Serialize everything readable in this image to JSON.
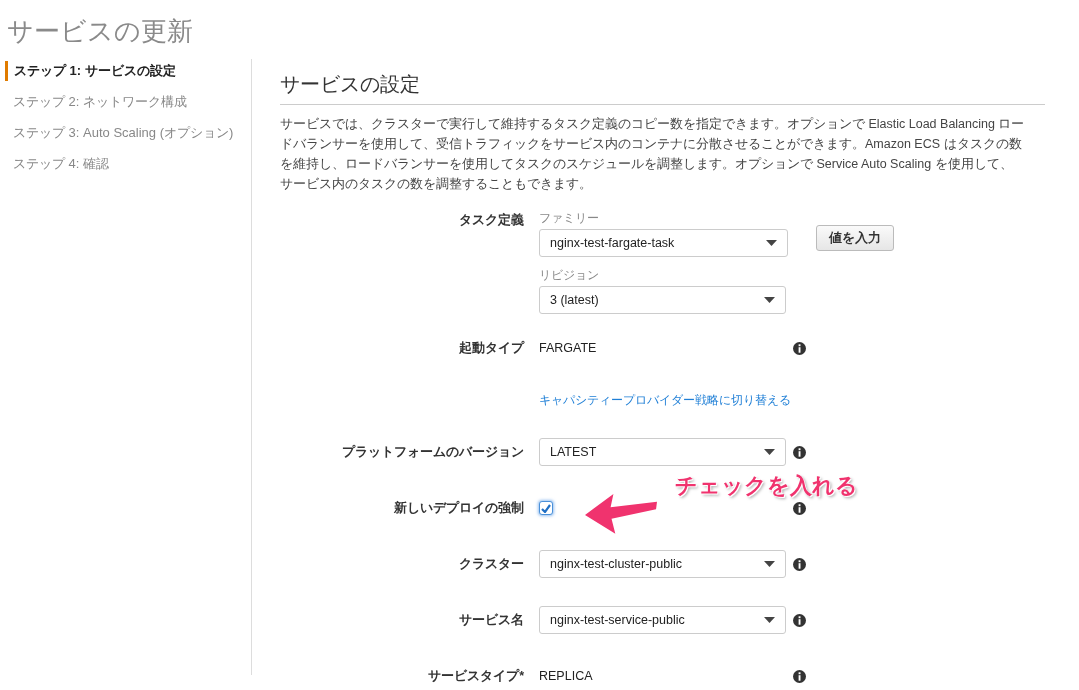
{
  "page_title": "サービスの更新",
  "steps": [
    {
      "label": "ステップ 1: サービスの設定",
      "selected": true
    },
    {
      "label": "ステップ 2: ネットワーク構成",
      "selected": false
    },
    {
      "label": "ステップ 3: Auto Scaling (オプション)",
      "selected": false
    },
    {
      "label": "ステップ 4: 確認",
      "selected": false
    }
  ],
  "section": {
    "title": "サービスの設定",
    "description": "サービスでは、クラスターで実行して維持するタスク定義のコピー数を指定できます。オプションで Elastic Load Balancing ロードバランサーを使用して、受信トラフィックをサービス内のコンテナに分散させることができます。Amazon ECS はタスクの数を維持し、ロードバランサーを使用してタスクのスケジュールを調整します。オプションで Service Auto Scaling を使用して、サービス内のタスクの数を調整することもできます。"
  },
  "fields": [
    {
      "kind": "task_definition",
      "label": "タスク定義",
      "selects": [
        {
          "caption": "ファミリー",
          "value": "nginx-test-fargate-task"
        },
        {
          "caption": "リビジョン",
          "value": "3 (latest)"
        }
      ],
      "button": "値を入力"
    },
    {
      "kind": "text",
      "label": "起動タイプ",
      "value": "FARGATE",
      "info": true
    },
    {
      "kind": "link",
      "text": "キャパシティープロバイダー戦略に切り替える"
    },
    {
      "kind": "select",
      "label": "プラットフォームのバージョン",
      "value": "LATEST",
      "info": true
    },
    {
      "kind": "checkbox",
      "label": "新しいデプロイの強制",
      "checked": true,
      "info": true
    },
    {
      "kind": "select",
      "label": "クラスター",
      "value": "nginx-test-cluster-public",
      "info": true
    },
    {
      "kind": "select",
      "label": "サービス名",
      "value": "nginx-test-service-public",
      "info": true
    },
    {
      "kind": "text",
      "label": "サービスタイプ*",
      "value": "REPLICA",
      "info": true
    }
  ],
  "annotation": {
    "text": "チェックを入れる"
  }
}
